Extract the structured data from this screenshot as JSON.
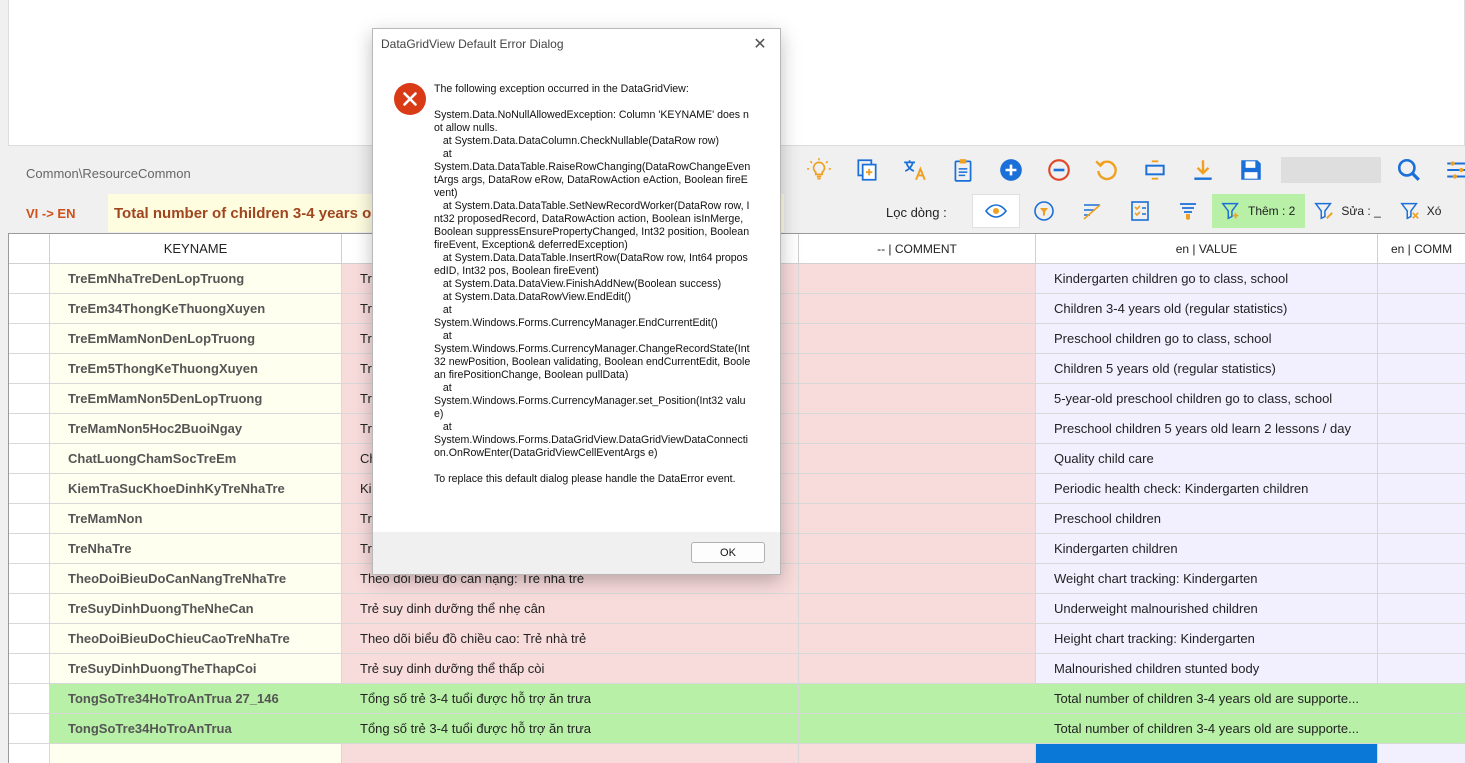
{
  "path": "Common\\ResourceCommon",
  "lang_label": "VI -> EN",
  "lang_text": "Total number of children 3-4 years o",
  "filter_label": "Lọc dòng :",
  "filter_add_label": "Thêm : 2",
  "filter_edit_label": "Sửa : _",
  "filter_delete_label": "Xó",
  "toolbar_icons": [
    "bulb-icon",
    "add-tab-icon",
    "translate-icon",
    "clipboard-icon",
    "plus-circle-icon",
    "minus-circle-icon",
    "undo-icon",
    "resize-icon",
    "download-icon",
    "save-icon",
    "search-icon",
    "settings-icon"
  ],
  "colors": {
    "accent_blue": "#1a6fd8",
    "icon_orange": "#f0a020",
    "row_green": "#b8f0a8",
    "vi_col": "#f8dcdc",
    "en_col": "#f2efff",
    "error_red": "#d93b17"
  },
  "grid": {
    "headers": [
      "",
      "KEYNAME",
      "",
      "-- | COMMENT",
      "en | VALUE",
      "en | COMM"
    ],
    "rows": [
      {
        "key": "TreEmNhaTreDenLopTruong",
        "vi": "Tr",
        "en": "Kindergarten children go to class, school"
      },
      {
        "key": "TreEm34ThongKeThuongXuyen",
        "vi": "Tr",
        "en": "Children 3-4 years old (regular statistics)"
      },
      {
        "key": "TreEmMamNonDenLopTruong",
        "vi": "Tr",
        "en": "Preschool children go to class, school"
      },
      {
        "key": "TreEm5ThongKeThuongXuyen",
        "vi": "Tr",
        "en": "Children 5 years old (regular statistics)"
      },
      {
        "key": "TreEmMamNon5DenLopTruong",
        "vi": "Tr",
        "en": "5-year-old preschool children go to class, school"
      },
      {
        "key": "TreMamNon5Hoc2BuoiNgay",
        "vi": "Tr",
        "en": "Preschool children 5 years old learn 2 lessons / day"
      },
      {
        "key": "ChatLuongChamSocTreEm",
        "vi": "Ch",
        "en": "Quality child care"
      },
      {
        "key": "KiemTraSucKhoeDinhKyTreNhaTre",
        "vi": "Ki",
        "en": "Periodic health check: Kindergarten children"
      },
      {
        "key": "TreMamNon",
        "vi": "Tr",
        "en": "Preschool children"
      },
      {
        "key": "TreNhaTre",
        "vi": "Tr",
        "en": "Kindergarten children"
      },
      {
        "key": "TheoDoiBieuDoCanNangTreNhaTre",
        "vi": "Theo dõi biểu đồ cân nặng: Trẻ nhà trẻ",
        "en": "Weight chart tracking: Kindergarten"
      },
      {
        "key": "TreSuyDinhDuongTheNheCan",
        "vi": "Trẻ suy dinh dưỡng thể nhẹ cân",
        "en": "Underweight malnourished children"
      },
      {
        "key": "TheoDoiBieuDoChieuCaoTreNhaTre",
        "vi": "Theo dõi biểu đồ chiều cao: Trẻ nhà trẻ",
        "en": "Height chart tracking: Kindergarten"
      },
      {
        "key": "TreSuyDinhDuongTheThapCoi",
        "vi": "Trẻ suy dinh dưỡng thể thấp còi",
        "en": "Malnourished children stunted body"
      },
      {
        "key": "TongSoTre34HoTroAnTrua 27_146",
        "vi": "Tổng số trẻ 3-4 tuổi được hỗ trợ ăn trưa",
        "en": "Total number of children 3-4 years old are supporte..."
      },
      {
        "key": "TongSoTre34HoTroAnTrua",
        "vi": "Tổng số trẻ 3-4 tuổi được hỗ trợ ăn trưa",
        "en": "Total number of children 3-4 years old are supporte..."
      }
    ]
  },
  "dialog": {
    "title": "DataGridView Default Error Dialog",
    "close_glyph": "✕",
    "intro": "The following exception occurred in the DataGridView:",
    "trace": "System.Data.NoNullAllowedException: Column 'KEYNAME' does not allow nulls.\n   at System.Data.DataColumn.CheckNullable(DataRow row)\n   at\nSystem.Data.DataTable.RaiseRowChanging(DataRowChangeEventArgs args, DataRow eRow, DataRowAction eAction, Boolean fireEvent)\n   at System.Data.DataTable.SetNewRecordWorker(DataRow row, Int32 proposedRecord, DataRowAction action, Boolean isInMerge, Boolean suppressEnsurePropertyChanged, Int32 position, Boolean fireEvent, Exception& deferredException)\n   at System.Data.DataTable.InsertRow(DataRow row, Int64 proposedID, Int32 pos, Boolean fireEvent)\n   at System.Data.DataView.FinishAddNew(Boolean success)\n   at System.Data.DataRowView.EndEdit()\n   at\nSystem.Windows.Forms.CurrencyManager.EndCurrentEdit()\n   at\nSystem.Windows.Forms.CurrencyManager.ChangeRecordState(Int32 newPosition, Boolean validating, Boolean endCurrentEdit, Boolean firePositionChange, Boolean pullData)\n   at\nSystem.Windows.Forms.CurrencyManager.set_Position(Int32 value)\n   at\nSystem.Windows.Forms.DataGridView.DataGridViewDataConnection.OnRowEnter(DataGridViewCellEventArgs e)",
    "outro": "To replace this default dialog please handle the DataError event.",
    "ok_label": "OK"
  }
}
